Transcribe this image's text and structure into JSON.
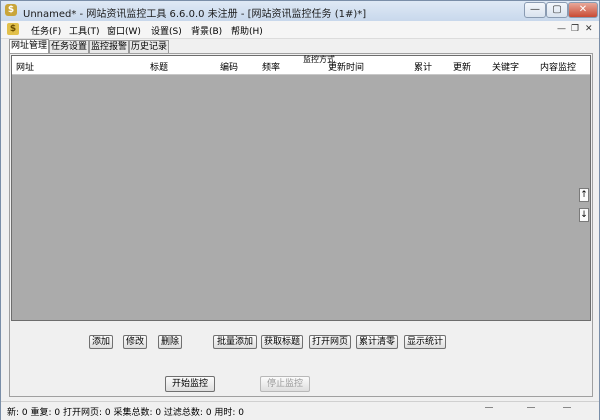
{
  "window": {
    "title": "Unnamed* - 网站资讯监控工具 6.6.0.0  未注册 - [网站资讯监控任务 (1#)*]",
    "controls": {
      "minimize": "—",
      "maximize": "▢",
      "close": "✕"
    }
  },
  "menubar": {
    "icon": "$",
    "items": [
      "任务(F)",
      "工具(T)",
      "窗口(W)",
      "设置(S)",
      "背景(B)",
      "帮助(H)"
    ],
    "mdi_controls": {
      "minimize": "—",
      "restore": "❐",
      "close": "✕"
    }
  },
  "tabs": [
    "网址管理",
    "任务设置",
    "监控报警",
    "历史记录"
  ],
  "grid": {
    "columns": [
      "网址",
      "标题",
      "编码",
      "频率",
      "监控方式",
      "更新时间",
      "累计",
      "更新",
      "关键字",
      "内容监控"
    ],
    "scroll_up": "↑",
    "scroll_down": "↓"
  },
  "buttons": {
    "add": "添加",
    "edit": "修改",
    "delete": "删除",
    "batch_add": "批量添加",
    "get_title": "获取标题",
    "open_page": "打开网页",
    "clear_count": "累计清零",
    "show_stats": "显示统计",
    "start": "开始监控",
    "stop": "停止监控"
  },
  "status": {
    "text": "新: 0  重复: 0  打开网页: 0  采集总数: 0  过滤总数: 0  用时: 0"
  }
}
